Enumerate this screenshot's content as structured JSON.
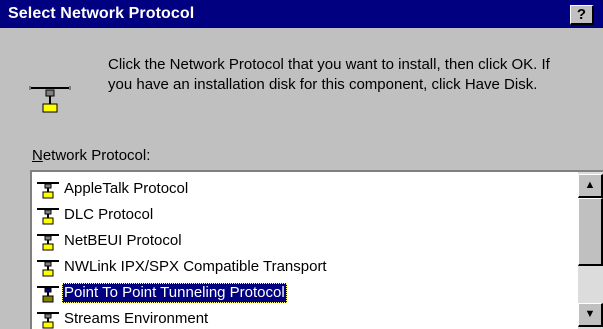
{
  "window": {
    "title": "Select Network Protocol",
    "help_glyph": "?"
  },
  "instructions": {
    "line1": "Click the Network Protocol that you want to install, then click OK.  If",
    "line2": "you have an installation disk for this component, click Have Disk.",
    "icon": "network-protocol-icon"
  },
  "protocol_list": {
    "label_mnemonic": "N",
    "label_rest": "etwork Protocol:",
    "items": [
      {
        "label": "AppleTalk Protocol",
        "icon": "network-protocol-icon",
        "selected": false
      },
      {
        "label": "DLC Protocol",
        "icon": "network-protocol-icon",
        "selected": false
      },
      {
        "label": "NetBEUI Protocol",
        "icon": "network-protocol-icon",
        "selected": false
      },
      {
        "label": "NWLink IPX/SPX Compatible Transport",
        "icon": "network-protocol-icon",
        "selected": false
      },
      {
        "label": "Point To Point Tunneling Protocol",
        "icon": "network-protocol-icon",
        "selected": true
      },
      {
        "label": "Streams Environment",
        "icon": "network-protocol-icon",
        "selected": false
      }
    ],
    "scroll_up_glyph": "▲",
    "scroll_down_glyph": "▼"
  },
  "colors": {
    "title_bar": "#000080",
    "selection": "#000080",
    "face": "#c0c0c0"
  }
}
